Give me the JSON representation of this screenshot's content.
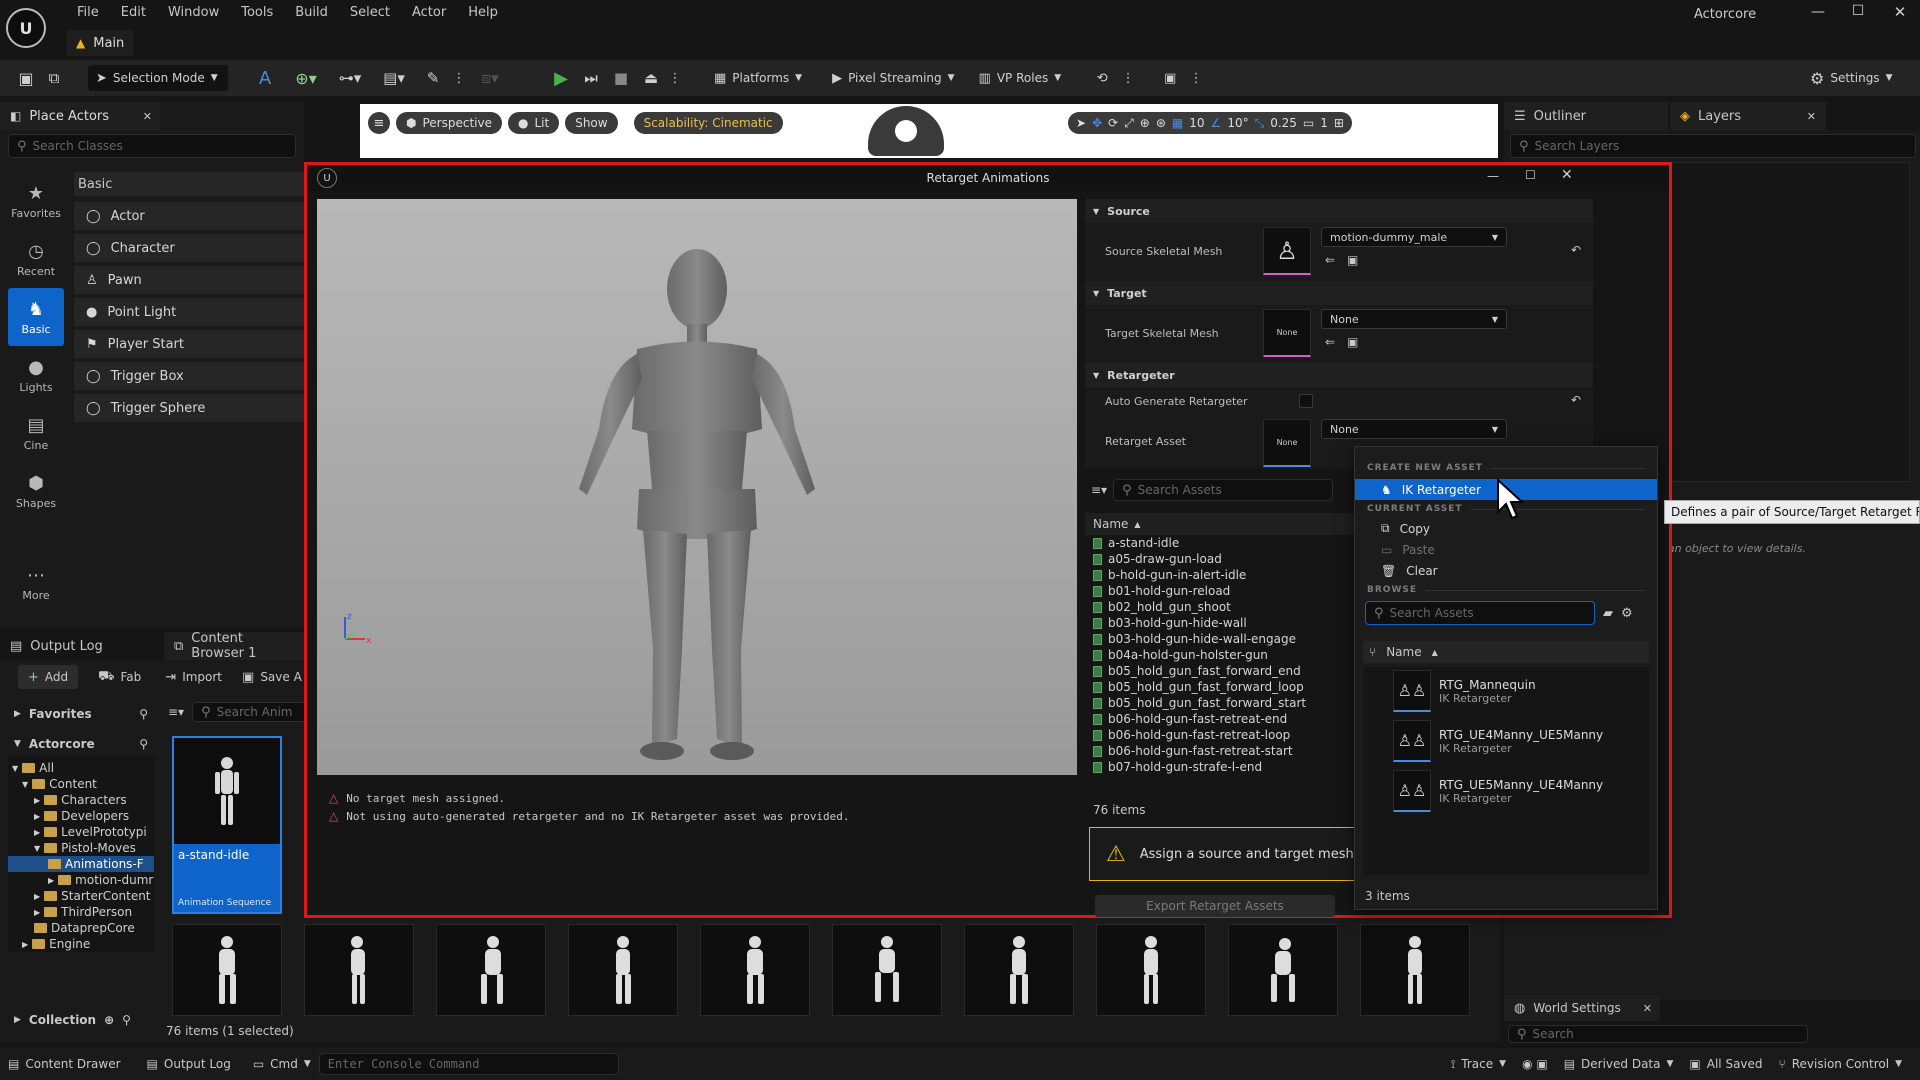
{
  "app": {
    "menu": [
      "File",
      "Edit",
      "Window",
      "Tools",
      "Build",
      "Select",
      "Actor",
      "Help"
    ],
    "project_name": "Actorcore",
    "level_tab": "Main"
  },
  "toolbar": {
    "selection_mode": "Selection Mode",
    "platforms": "Platforms",
    "pixel_streaming": "Pixel Streaming",
    "vp_roles": "VP Roles",
    "settings": "Settings"
  },
  "viewport_bar": {
    "perspective": "Perspective",
    "lit": "Lit",
    "show": "Show",
    "scalability": "Scalability: Cinematic",
    "grid_value": "10",
    "angle_value": "10°",
    "scale_value": "0.25",
    "camera_value": "1"
  },
  "place_actors": {
    "tab": "Place Actors",
    "search_placeholder": "Search Classes",
    "category": "Basic",
    "sidebar": [
      {
        "label": "Favorites",
        "icon": "star-icon"
      },
      {
        "label": "Recent",
        "icon": "clock-icon"
      },
      {
        "label": "Basic",
        "icon": "shapes-icon"
      },
      {
        "label": "Lights",
        "icon": "bulb-icon"
      },
      {
        "label": "Cine",
        "icon": "clapper-icon"
      },
      {
        "label": "Shapes",
        "icon": "cube-icon"
      },
      {
        "label": "More",
        "icon": "ellipsis-icon"
      }
    ],
    "items": [
      "Actor",
      "Character",
      "Pawn",
      "Point Light",
      "Player Start",
      "Trigger Box",
      "Trigger Sphere"
    ]
  },
  "outliner": {
    "tab_outliner": "Outliner",
    "tab_layers": "Layers",
    "search_placeholder": "Search Layers",
    "hint": "ct an object to view details.",
    "world_settings": "World Settings",
    "world_search_placeholder": "Search"
  },
  "content_browser": {
    "tab_output_log": "Output Log",
    "tab_content_browser": "Content Browser 1",
    "add": "Add",
    "fab": "Fab",
    "import": "Import",
    "save_all": "Save A",
    "favorites": "Favorites",
    "root": "Actorcore",
    "search_placeholder": "Search Anim",
    "tree": [
      {
        "label": "All",
        "depth": 0
      },
      {
        "label": "Content",
        "depth": 1
      },
      {
        "label": "Characters",
        "depth": 2
      },
      {
        "label": "Developers",
        "depth": 2
      },
      {
        "label": "LevelPrototypi",
        "depth": 2
      },
      {
        "label": "Pistol-Moves",
        "depth": 2
      },
      {
        "label": "Animations-F",
        "depth": 3
      },
      {
        "label": "motion-dumr",
        "depth": 3
      },
      {
        "label": "StarterContent",
        "depth": 2
      },
      {
        "label": "ThirdPerson",
        "depth": 2
      },
      {
        "label": "DataprepCore",
        "depth": 1
      },
      {
        "label": "Engine",
        "depth": 1
      }
    ],
    "selected_asset": {
      "name": "a-stand-idle",
      "type": "Animation Sequence"
    },
    "collection": "Collection",
    "status": "76 items (1 selected)"
  },
  "dialog": {
    "title": "Retarget Animations",
    "warnings": [
      "No target mesh assigned.",
      "Not using auto-generated retargeter and no IK Retargeter asset was provided."
    ],
    "sections": {
      "source": "Source",
      "target": "Target",
      "retargeter": "Retargeter"
    },
    "source_mesh_label": "Source Skeletal Mesh",
    "source_mesh_value": "motion-dummy_male",
    "target_mesh_label": "Target Skeletal Mesh",
    "target_mesh_value": "None",
    "target_thumb": "None",
    "auto_generate_label": "Auto Generate Retargeter",
    "retarget_asset_label": "Retarget Asset",
    "retarget_asset_value": "None",
    "retarget_thumb": "None",
    "asset_search_placeholder": "Search Assets",
    "name_column": "Name",
    "animations": [
      "a-stand-idle",
      "a05-draw-gun-load",
      "b-hold-gun-in-alert-idle",
      "b01-hold-gun-reload",
      "b02_hold_gun_shoot",
      "b03-hold-gun-hide-wall",
      "b03-hold-gun-hide-wall-engage",
      "b04a-hold-gun-holster-gun",
      "b05_hold_gun_fast_forward_end",
      "b05_hold_gun_fast_forward_loop",
      "b05_hold_gun_fast_forward_start",
      "b06-hold-gun-fast-retreat-end",
      "b06-hold-gun-fast-retreat-loop",
      "b06-hold-gun-fast-retreat-start",
      "b07-hold-gun-strafe-l-end"
    ],
    "item_count": "76 items",
    "assign_warning": "Assign a source and target mesh to tra",
    "export_button": "Export Retarget Assets"
  },
  "asset_menu": {
    "create_new_header": "CREATE NEW ASSET",
    "ik_retargeter": "IK Retargeter",
    "tooltip": "Defines a pair of Source/Target Retarget Rigs",
    "current_header": "CURRENT ASSET",
    "copy": "Copy",
    "paste": "Paste",
    "clear": "Clear",
    "browse_header": "BROWSE",
    "search_placeholder": "Search Assets",
    "name_column": "Name",
    "assets": [
      {
        "name": "RTG_Mannequin",
        "type": "IK Retargeter"
      },
      {
        "name": "RTG_UE4Manny_UE5Manny",
        "type": "IK Retargeter"
      },
      {
        "name": "RTG_UE5Manny_UE4Manny",
        "type": "IK Retargeter"
      }
    ],
    "count": "3 items"
  },
  "statusbar": {
    "content_drawer": "Content Drawer",
    "output_log": "Output Log",
    "cmd": "Cmd",
    "console_placeholder": "Enter Console Command",
    "trace": "Trace",
    "derived_data": "Derived Data",
    "all_saved": "All Saved",
    "revision_control": "Revision Control"
  },
  "colors": {
    "accent_blue": "#0e64c8",
    "highlight_red": "#e0161b",
    "warning_yellow": "#e8b41c",
    "play_green": "#4caf50"
  }
}
